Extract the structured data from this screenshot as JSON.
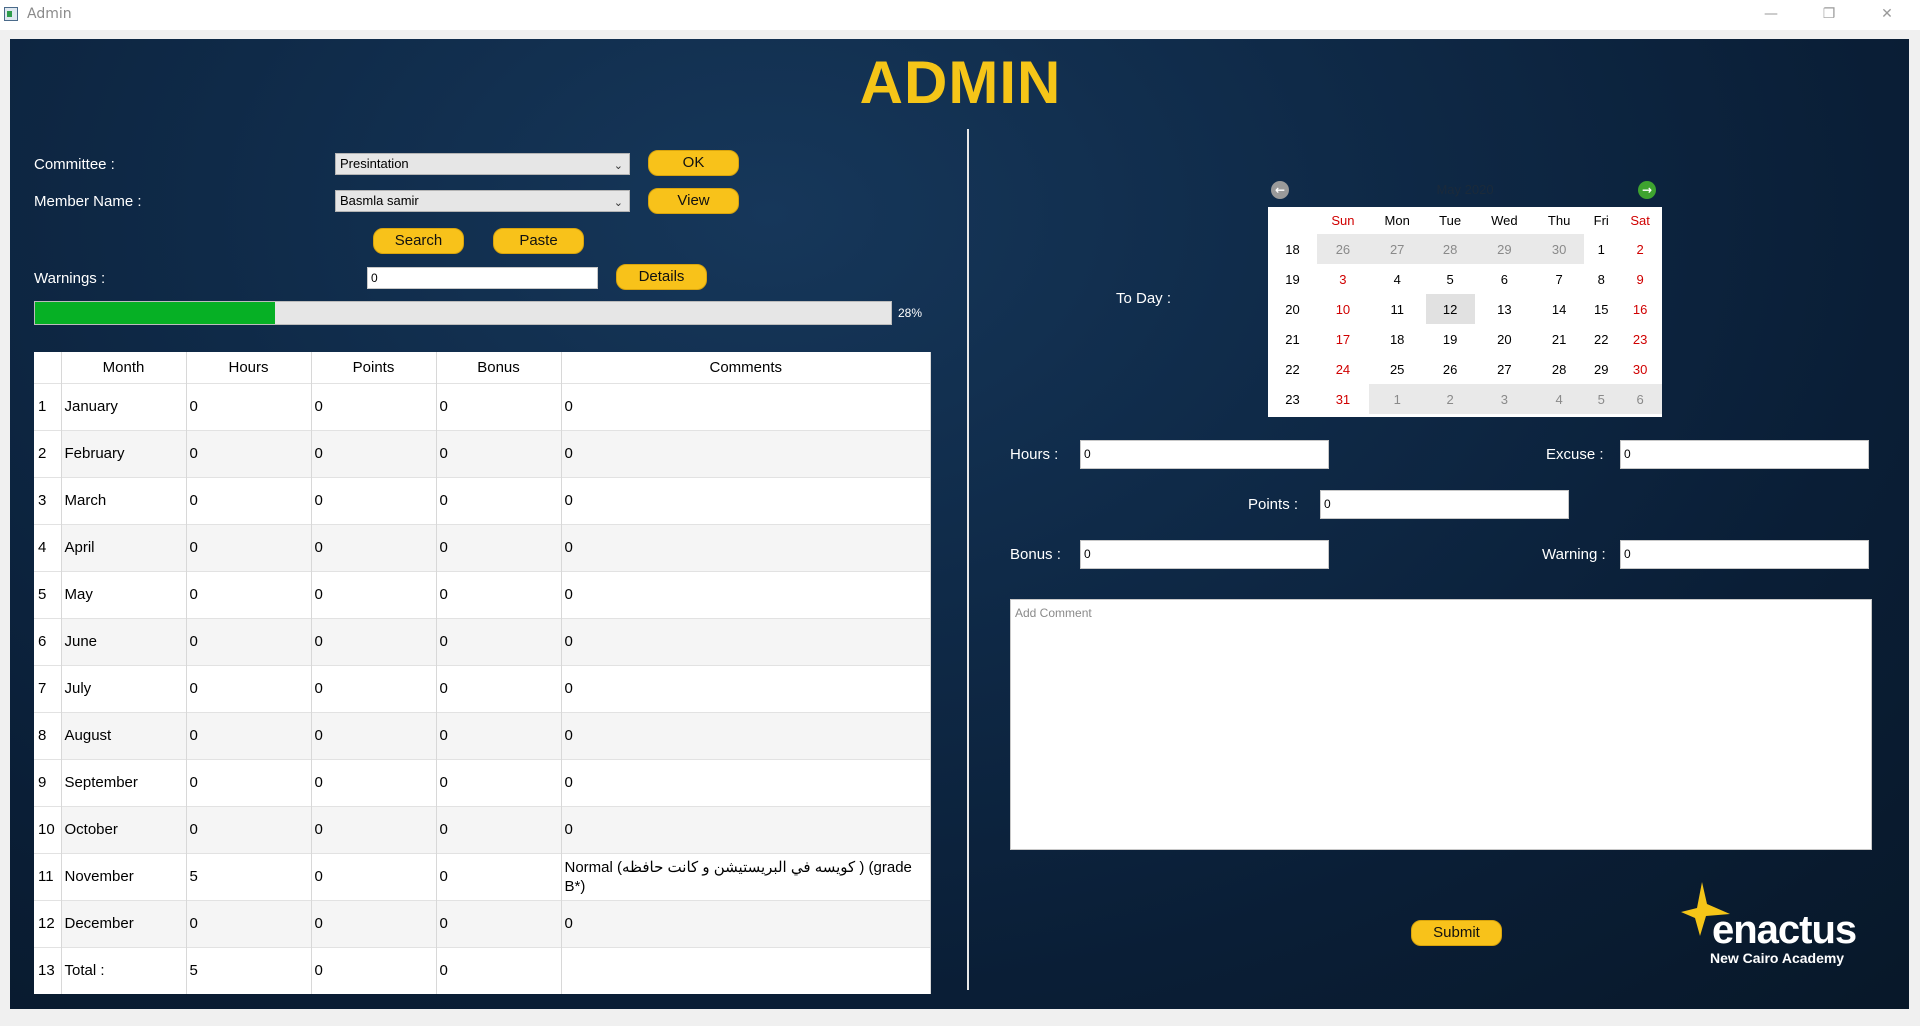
{
  "window": {
    "title": "Admin",
    "minimize": "—",
    "restore": "❐",
    "close": "✕"
  },
  "header": {
    "title": "ADMIN"
  },
  "form": {
    "committee_label": "Committee :",
    "committee_value": "Presintation",
    "member_label": "Member Name :",
    "member_value": "Basmla samir",
    "ok_label": "OK",
    "view_label": "View",
    "search_label": "Search",
    "paste_label": "Paste",
    "warnings_label": "Warnings :",
    "warnings_value": "0",
    "details_label": "Details",
    "progress_text": "28%",
    "progress_value": 0.28
  },
  "table": {
    "headers": [
      "Month",
      "Hours",
      "Points",
      "Bonus",
      "Comments"
    ],
    "rows": [
      {
        "num": "1",
        "month": "January",
        "hours": "0",
        "points": "0",
        "bonus": "0",
        "comments": "0"
      },
      {
        "num": "2",
        "month": "February",
        "hours": "0",
        "points": "0",
        "bonus": "0",
        "comments": "0"
      },
      {
        "num": "3",
        "month": "March",
        "hours": "0",
        "points": "0",
        "bonus": "0",
        "comments": "0"
      },
      {
        "num": "4",
        "month": "April",
        "hours": "0",
        "points": "0",
        "bonus": "0",
        "comments": "0"
      },
      {
        "num": "5",
        "month": "May",
        "hours": "0",
        "points": "0",
        "bonus": "0",
        "comments": "0"
      },
      {
        "num": "6",
        "month": "June",
        "hours": "0",
        "points": "0",
        "bonus": "0",
        "comments": "0"
      },
      {
        "num": "7",
        "month": "July",
        "hours": "0",
        "points": "0",
        "bonus": "0",
        "comments": "0"
      },
      {
        "num": "8",
        "month": "August",
        "hours": "0",
        "points": "0",
        "bonus": "0",
        "comments": "0"
      },
      {
        "num": "9",
        "month": "September",
        "hours": "0",
        "points": "0",
        "bonus": "0",
        "comments": "0"
      },
      {
        "num": "10",
        "month": "October",
        "hours": "0",
        "points": "0",
        "bonus": "0",
        "comments": "0"
      },
      {
        "num": "11",
        "month": "November",
        "hours": "5",
        "points": "0",
        "bonus": "0",
        "comments": "Normal (كويسه في البريستيشن و كانت حافظه ) (grade B*)"
      },
      {
        "num": "12",
        "month": "December",
        "hours": "0",
        "points": "0",
        "bonus": "0",
        "comments": "0"
      },
      {
        "num": "13",
        "month": "Total :",
        "hours": "5",
        "points": "0",
        "bonus": "0",
        "comments": ""
      }
    ]
  },
  "calendar": {
    "today_label": "To Day :",
    "month": "May",
    "year": "2020",
    "prev_icon": "arrow-left-icon",
    "next_icon": "arrow-right-icon",
    "day_headers": [
      "Sun",
      "Mon",
      "Tue",
      "Wed",
      "Thu",
      "Fri",
      "Sat"
    ],
    "weeks": [
      {
        "wk": "18",
        "days": [
          "26",
          "27",
          "28",
          "29",
          "30",
          "1",
          "2"
        ]
      },
      {
        "wk": "19",
        "days": [
          "3",
          "4",
          "5",
          "6",
          "7",
          "8",
          "9"
        ]
      },
      {
        "wk": "20",
        "days": [
          "10",
          "11",
          "12",
          "13",
          "14",
          "15",
          "16"
        ]
      },
      {
        "wk": "21",
        "days": [
          "17",
          "18",
          "19",
          "20",
          "21",
          "22",
          "23"
        ]
      },
      {
        "wk": "22",
        "days": [
          "24",
          "25",
          "26",
          "27",
          "28",
          "29",
          "30"
        ]
      },
      {
        "wk": "23",
        "days": [
          "31",
          "1",
          "2",
          "3",
          "4",
          "5",
          "6"
        ]
      }
    ],
    "selected_day": "12",
    "weekend_color": "#d00000"
  },
  "entry": {
    "hours_label": "Hours :",
    "hours_value": "0",
    "excuse_label": "Excuse :",
    "excuse_value": "0",
    "points_label": "Points :",
    "points_value": "0",
    "bonus_label": "Bonus :",
    "bonus_value": "0",
    "warning_label": "Warning :",
    "warning_value": "0",
    "comment_placeholder": "Add Comment",
    "submit_label": "Submit"
  },
  "logo": {
    "name": "enactus",
    "subtitle": "New Cairo Academy"
  },
  "colors": {
    "accent": "#f5c518",
    "button": "#f8c21a",
    "progress": "#06b025",
    "background": "#0f2a48"
  }
}
